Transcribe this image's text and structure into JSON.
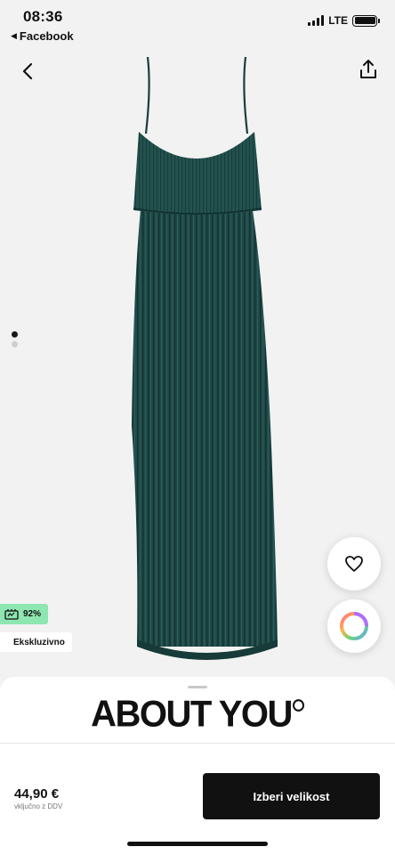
{
  "status_bar": {
    "time": "08:36",
    "back_app_label": "Facebook",
    "network": "LTE",
    "signal_bars": 4,
    "battery_level": 1.0
  },
  "nav": {
    "back_icon": "chevron-left-icon",
    "share_icon": "share-icon"
  },
  "product": {
    "image_subject": "dark teal pleated maxi dress",
    "dress_color": "#1f4a48",
    "image_count": 2,
    "active_image": 1
  },
  "badges": {
    "sustainability_value": "92%",
    "exclusive_label": "Ekskluzivno",
    "sustainability_color": "#8ee6b1"
  },
  "actions": {
    "wishlist_icon": "heart-icon",
    "color_icon": "color-wheel-icon"
  },
  "brand": {
    "name": "ABOUT YOU"
  },
  "purchase": {
    "price": "44,90 €",
    "vat_note": "vključno z DDV",
    "cta_label": "Izberi velikost"
  }
}
